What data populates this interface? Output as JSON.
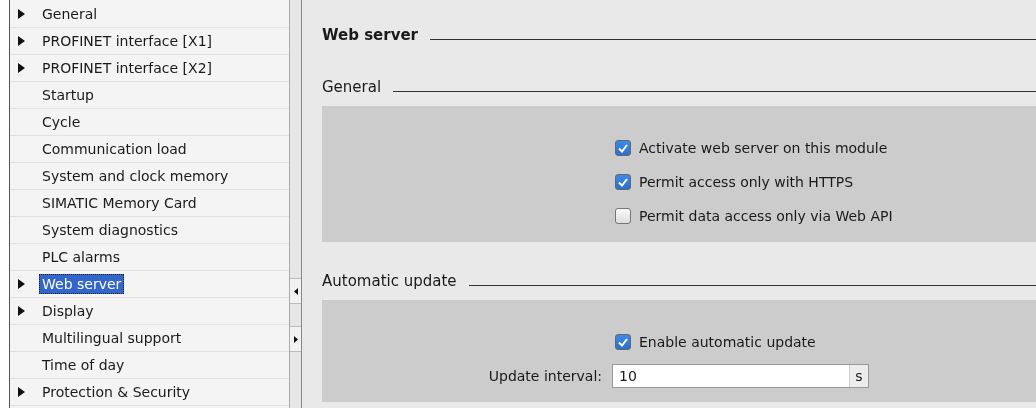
{
  "sidebar": {
    "items": [
      {
        "label": "General",
        "kind": "group",
        "selected": false
      },
      {
        "label": "PROFINET interface [X1]",
        "kind": "group",
        "selected": false
      },
      {
        "label": "PROFINET interface [X2]",
        "kind": "group",
        "selected": false
      },
      {
        "label": "Startup",
        "kind": "item",
        "selected": false
      },
      {
        "label": "Cycle",
        "kind": "item",
        "selected": false
      },
      {
        "label": "Communication load",
        "kind": "item",
        "selected": false
      },
      {
        "label": "System and clock memory",
        "kind": "item",
        "selected": false
      },
      {
        "label": "SIMATIC Memory Card",
        "kind": "item",
        "selected": false
      },
      {
        "label": "System diagnostics",
        "kind": "item",
        "selected": false
      },
      {
        "label": "PLC alarms",
        "kind": "item",
        "selected": false
      },
      {
        "label": "Web server",
        "kind": "group",
        "selected": true
      },
      {
        "label": "Display",
        "kind": "group",
        "selected": false
      },
      {
        "label": "Multilingual support",
        "kind": "item",
        "selected": false
      },
      {
        "label": "Time of day",
        "kind": "item",
        "selected": false
      },
      {
        "label": "Protection & Security",
        "kind": "group",
        "selected": false
      }
    ]
  },
  "content": {
    "title": "Web server",
    "sections": [
      {
        "heading": "General",
        "options": [
          {
            "label": "Activate web server on this module",
            "checked": true
          },
          {
            "label": "Permit access only with HTTPS",
            "checked": true
          },
          {
            "label": "Permit data access only via Web API",
            "checked": false
          }
        ]
      },
      {
        "heading": "Automatic update",
        "options": [
          {
            "label": "Enable automatic update",
            "checked": true
          }
        ],
        "field": {
          "label": "Update interval:",
          "value": "10",
          "unit": "s"
        }
      }
    ]
  }
}
